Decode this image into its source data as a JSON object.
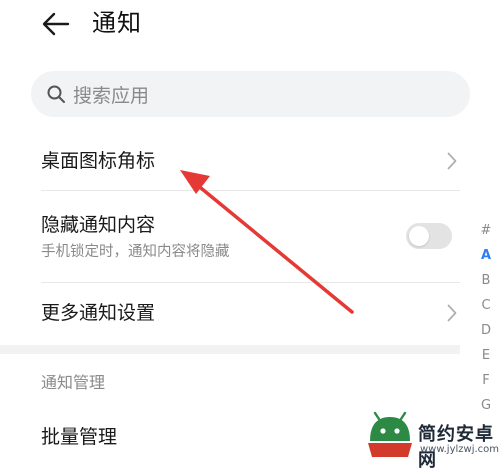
{
  "header": {
    "title": "通知",
    "back_icon": "arrow-left-icon"
  },
  "search": {
    "placeholder": "搜索应用",
    "icon": "search-icon"
  },
  "rows": [
    {
      "label": "桌面图标角标",
      "control": "chevron"
    },
    {
      "label": "隐藏通知内容",
      "sublabel": "手机锁定时，通知内容将隐藏",
      "control": "toggle",
      "toggle_on": false
    },
    {
      "label": "更多通知设置",
      "control": "chevron"
    }
  ],
  "section": {
    "title": "通知管理"
  },
  "section_rows": [
    {
      "label": "批量管理"
    }
  ],
  "alphabet": [
    "#",
    "A",
    "B",
    "C",
    "D",
    "E",
    "F",
    "G"
  ],
  "alphabet_active": "A",
  "watermark": {
    "name": "简约安卓网",
    "url": "www.jylzwj.com"
  },
  "colors": {
    "accent": "#2f7ef5",
    "annotation": "#e53935",
    "toggle_off": "#e3e3e3"
  }
}
